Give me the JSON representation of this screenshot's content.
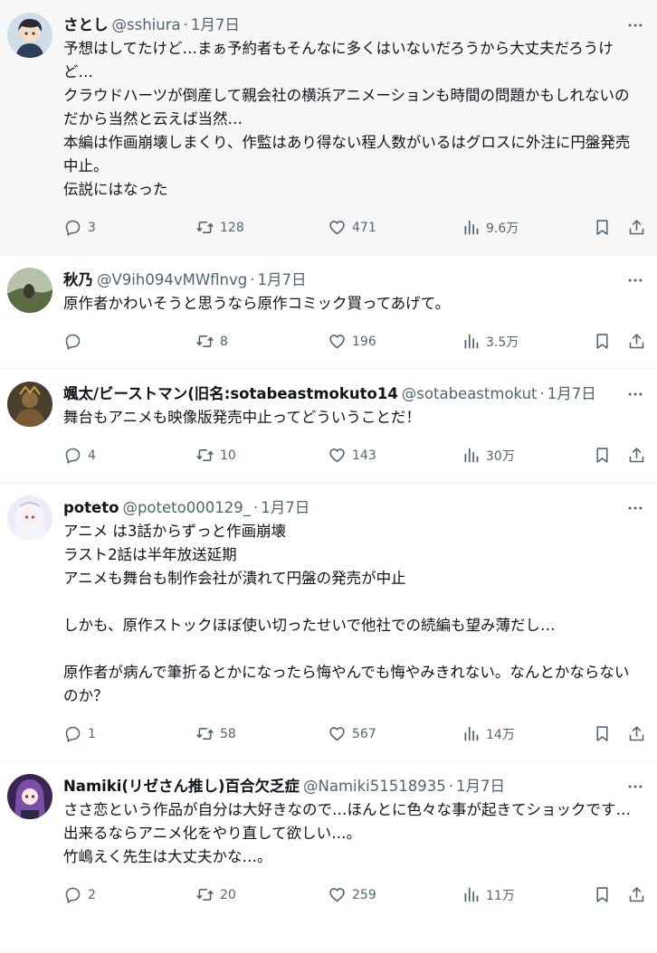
{
  "posts": [
    {
      "name": "さとし",
      "handle": "@sshiura",
      "time": "1月7日",
      "text": "予想はしてたけど…まぁ予約者もそんなに多くはいないだろうから大丈夫だろうけど…\nクラウドハーツが倒産して親会社の横浜アニメーションも時間の問題かもしれないのだから当然と云えば当然…\n本編は作画崩壊しまくり、作監はあり得ない程人数がいるはグロスに外注に円盤発売中止。\n伝説にはなった",
      "replies": "3",
      "reposts": "128",
      "likes": "471",
      "views": "9.6万",
      "avatar_color": "#c9d8e6"
    },
    {
      "name": "秋乃",
      "handle": "@V9ih094vMWflnvg",
      "time": "1月7日",
      "text": "原作者かわいそうと思うなら原作コミック買ってあげて。",
      "replies": "",
      "reposts": "8",
      "likes": "196",
      "views": "3.5万",
      "avatar_color": "#6f7b5a"
    },
    {
      "name": "颯太/ビーストマン(旧名:sotabeastmokuto14",
      "handle": "@sotabeastmokut",
      "time": "1月7日",
      "text": "舞台もアニメも映像版発売中止ってどういうことだ！",
      "replies": "4",
      "reposts": "10",
      "likes": "143",
      "views": "30万",
      "avatar_color": "#6b5a3a"
    },
    {
      "name": "poteto",
      "handle": "@poteto000129_",
      "time": "1月7日",
      "text": "アニメ は3話からずっと作画崩壊\nラスト2話は半年放送延期\nアニメも舞台も制作会社が潰れて円盤の発売が中止\n\nしかも、原作ストックほぼ使い切ったせいで他社での続編も望み薄だし…\n\n原作者が病んで筆折るとかになったら悔やんでも悔やみきれない。なんとかならないのか？",
      "replies": "1",
      "reposts": "58",
      "likes": "567",
      "views": "14万",
      "avatar_color": "#e8e4f2"
    },
    {
      "name": "Namiki(リゼさん推し)百合欠乏症",
      "handle": "@Namiki51518935",
      "time": "1月7日",
      "text": "ささ恋という作品が自分は大好きなので…ほんとに色々な事が起きてショックです…\n出来るならアニメ化をやり直して欲しい…。\n竹嶋えく先生は大丈夫かな…。",
      "replies": "2",
      "reposts": "20",
      "likes": "259",
      "views": "11万",
      "avatar_color": "#6a3f8c"
    }
  ],
  "separator": "·",
  "colors": {
    "text": "#0f1419",
    "muted": "#536471",
    "hover_bg": "#f7f7f7",
    "border": "#eff3f4"
  },
  "icons": [
    "reply-icon",
    "repost-icon",
    "like-icon",
    "views-icon",
    "bookmark-icon",
    "share-icon",
    "more-icon"
  ]
}
